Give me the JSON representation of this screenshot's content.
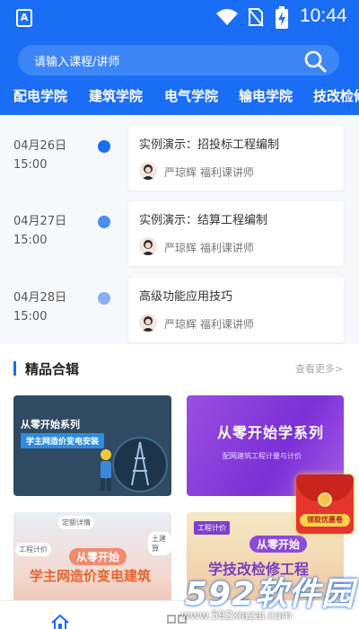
{
  "status_bar": {
    "app_badge": "A",
    "time": "10:44"
  },
  "search": {
    "placeholder": "请输入课程/讲师"
  },
  "categories": [
    "配电学院",
    "建筑学院",
    "电气学院",
    "输电学院",
    "技改检修"
  ],
  "schedule": [
    {
      "date": "04月26日",
      "time": "15:00",
      "title": "实例演示：招投标工程编制",
      "teacher": "严琼辉 福利课讲师"
    },
    {
      "date": "04月27日",
      "time": "15:00",
      "title": "实例演示：结算工程编制",
      "teacher": "严琼辉 福利课讲师"
    },
    {
      "date": "04月28日",
      "time": "15:00",
      "title": "高级功能应用技巧",
      "teacher": "严琼辉 福利课讲师"
    }
  ],
  "section": {
    "title": "精品合辑",
    "more": "查看更多>"
  },
  "cards": [
    {
      "title": "从零开始系列",
      "subtitle": "学主网造价变电安装"
    },
    {
      "title": "从零开始学系列",
      "subtitle": "配网建筑工程计量与计价"
    },
    {
      "title": "从零开始",
      "subtitle": "学主网造价变电建筑",
      "tags": [
        "工程计价",
        "土建算",
        "定额详情"
      ]
    },
    {
      "title": "从零开始",
      "subtitle": "学技改检修工程",
      "tags": [
        "工程计价"
      ]
    }
  ],
  "red_envelope": {
    "label": "领取优惠卷"
  },
  "watermark": {
    "brand": "592软件园",
    "url": "www.592xiazai.com"
  },
  "colors": {
    "primary": "#1a6df5",
    "dot_dark": "#1a6df5",
    "dot_mid": "#4a8cf3",
    "dot_light": "#86b1f2"
  }
}
